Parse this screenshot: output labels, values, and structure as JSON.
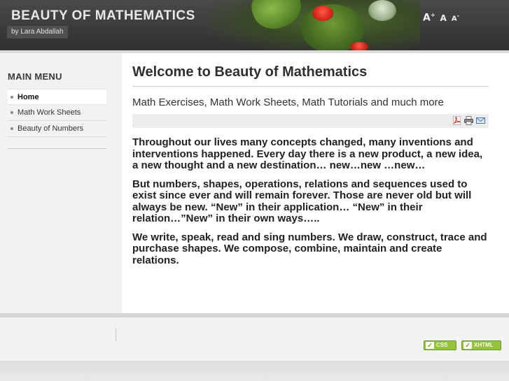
{
  "header": {
    "site_title": "BEAUTY OF MATHEMATICS",
    "byline": "by Lara Abdallah",
    "font_tools": {
      "increase": "A",
      "reset": "A",
      "decrease": "A",
      "increase_mark": "+",
      "decrease_mark": "-"
    }
  },
  "sidebar": {
    "menu_title": "MAIN MENU",
    "items": [
      {
        "label": "Home",
        "active": true
      },
      {
        "label": "Math Work Sheets",
        "active": false
      },
      {
        "label": "Beauty of Numbers",
        "active": false
      }
    ]
  },
  "main": {
    "page_title": "Welcome to Beauty of Mathematics",
    "subtitle": "Math Exercises, Math Work Sheets, Math Tutorials and much more",
    "tools": [
      "pdf-icon",
      "print-icon",
      "email-icon"
    ],
    "paragraphs": [
      "Throughout our lives many concepts changed, many inventions and interventions happened. Every day there is a new product, a new idea, a new thought and a new destination… new…new …new…",
      "But numbers, shapes, operations, relations and sequences used to exist since ever and will remain forever. Those are never old but will always be new. “New” in their application… “New” in their relation…”New” in their own ways…..",
      "We write, speak, read and sing numbers. We draw, construct, trace and purchase shapes. We compose, combine, maintain and create relations."
    ]
  },
  "footer": {
    "css_badge": "CSS",
    "xhtml_badge": "XHTML"
  },
  "colors": {
    "header_bg": "#3a3a3a",
    "accent_green": "#94c23c"
  }
}
